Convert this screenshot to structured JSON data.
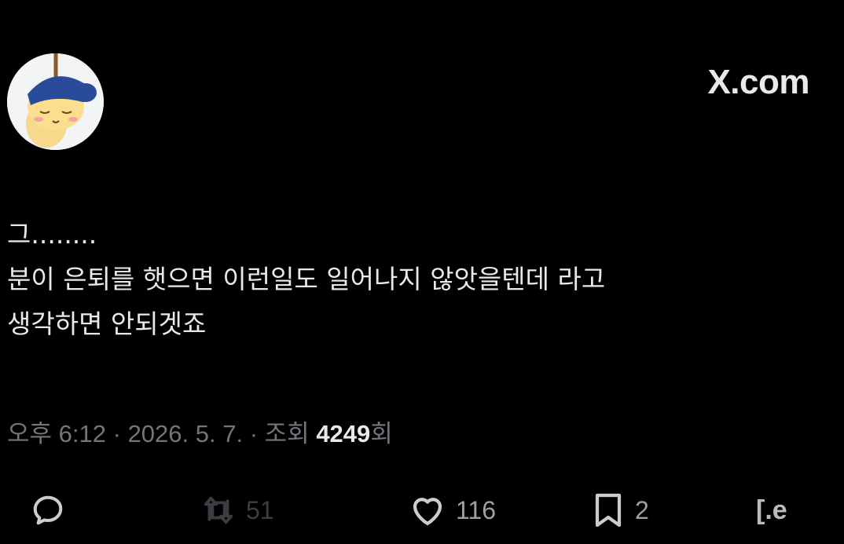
{
  "header": {
    "site_label": "X.com"
  },
  "tweet": {
    "lines": [
      "그........",
      "분이 은퇴를 햇으면 이런일도 일어나지 않앗을텐데 라고",
      "생각하면 안되겟죠"
    ],
    "meta": {
      "time": "오후 6:12",
      "separator": " · ",
      "date": "2026. 5. 7.",
      "views_label": "조회",
      "views_count": "4249",
      "views_suffix": "회"
    }
  },
  "actions": {
    "reply_icon": "reply-icon",
    "retweet_count": "51",
    "like_count": "116",
    "bookmark_count": "2",
    "share_glyph": "[.e"
  },
  "colors": {
    "background": "#000000",
    "text": "#e7e9ea",
    "muted": "#71767b"
  }
}
